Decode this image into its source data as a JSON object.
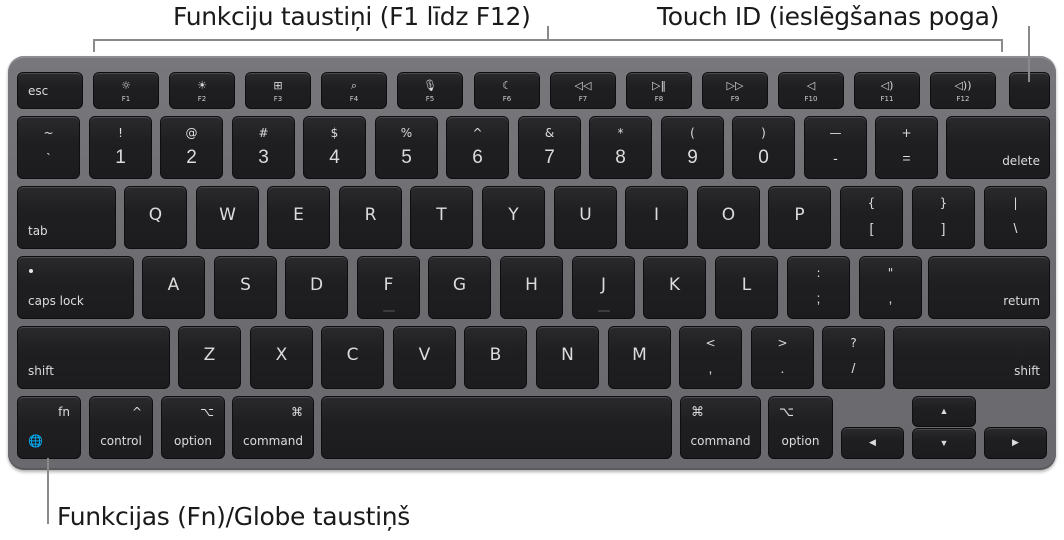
{
  "callouts": {
    "function_keys": "Funkciju taustiņi (F1 līdz F12)",
    "touch_id": "Touch ID (ieslēgšanas poga)",
    "fn_globe": "Funkcijas (Fn)/Globe taustiņš"
  },
  "colors": {
    "keyboard_body": "#6e6e72",
    "key": "#1f1f21",
    "key_label": "#dcdcdc",
    "callout_line": "#8a8a8a"
  },
  "function_row": {
    "esc": "esc",
    "keys": [
      {
        "label": "F1",
        "icon": "☼",
        "icon_name": "brightness-down-icon"
      },
      {
        "label": "F2",
        "icon": "☀",
        "icon_name": "brightness-up-icon"
      },
      {
        "label": "F3",
        "icon": "⊞",
        "icon_name": "mission-control-icon"
      },
      {
        "label": "F4",
        "icon": "⌕",
        "icon_name": "spotlight-search-icon"
      },
      {
        "label": "F5",
        "icon": "🎙",
        "icon_name": "dictation-mic-icon"
      },
      {
        "label": "F6",
        "icon": "☾",
        "icon_name": "do-not-disturb-moon-icon"
      },
      {
        "label": "F7",
        "icon": "◁◁",
        "icon_name": "rewind-icon"
      },
      {
        "label": "F8",
        "icon": "▷‖",
        "icon_name": "play-pause-icon"
      },
      {
        "label": "F9",
        "icon": "▷▷",
        "icon_name": "fast-forward-icon"
      },
      {
        "label": "F10",
        "icon": "◁",
        "icon_name": "mute-icon"
      },
      {
        "label": "F11",
        "icon": "◁)",
        "icon_name": "volume-down-icon"
      },
      {
        "label": "F12",
        "icon": "◁))",
        "icon_name": "volume-up-icon"
      }
    ]
  },
  "number_row": {
    "keys": [
      {
        "top": "~",
        "bottom": "`"
      },
      {
        "top": "!",
        "bottom": "1"
      },
      {
        "top": "@",
        "bottom": "2"
      },
      {
        "top": "#",
        "bottom": "3"
      },
      {
        "top": "$",
        "bottom": "4"
      },
      {
        "top": "%",
        "bottom": "5"
      },
      {
        "top": "^",
        "bottom": "6"
      },
      {
        "top": "&",
        "bottom": "7"
      },
      {
        "top": "*",
        "bottom": "8"
      },
      {
        "top": "(",
        "bottom": "9"
      },
      {
        "top": ")",
        "bottom": "0"
      },
      {
        "top": "—",
        "bottom": "-"
      },
      {
        "top": "+",
        "bottom": "="
      }
    ],
    "delete": "delete"
  },
  "qwerty_row": {
    "tab": "tab",
    "letters": [
      "Q",
      "W",
      "E",
      "R",
      "T",
      "Y",
      "U",
      "I",
      "O",
      "P"
    ],
    "brackets": [
      {
        "top": "{",
        "bottom": "["
      },
      {
        "top": "}",
        "bottom": "]"
      },
      {
        "top": "|",
        "bottom": "\\"
      }
    ]
  },
  "home_row": {
    "caps_lock": "caps lock",
    "letters": [
      "A",
      "S",
      "D",
      "F",
      "G",
      "H",
      "J",
      "K",
      "L"
    ],
    "punct": [
      {
        "top": ":",
        "bottom": ";"
      },
      {
        "top": "\"",
        "bottom": ","
      }
    ],
    "return": "return"
  },
  "shift_row": {
    "left_shift": "shift",
    "letters": [
      "Z",
      "X",
      "C",
      "V",
      "B",
      "N",
      "M"
    ],
    "punct": [
      {
        "top": "<",
        "bottom": ","
      },
      {
        "top": ">",
        "bottom": "."
      },
      {
        "top": "?",
        "bottom": "/"
      }
    ],
    "right_shift": "shift"
  },
  "bottom_row": {
    "fn": "fn",
    "globe_icon": "🌐",
    "control": "control",
    "control_symbol": "^",
    "option": "option",
    "option_symbol": "⌥",
    "command": "command",
    "command_symbol": "⌘",
    "arrows": {
      "left": "◀",
      "up": "▲",
      "down": "▼",
      "right": "▶"
    }
  }
}
